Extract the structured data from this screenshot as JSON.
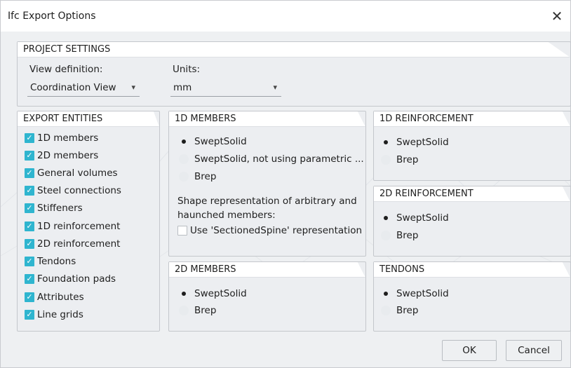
{
  "window": {
    "title": "Ifc Export Options"
  },
  "project_settings": {
    "header": "PROJECT SETTINGS",
    "view_definition_label": "View definition:",
    "view_definition_value": "Coordination View",
    "units_label": "Units:",
    "units_value": "mm"
  },
  "export_entities": {
    "header": "EXPORT ENTITIES",
    "items": [
      {
        "label": "1D members",
        "checked": true
      },
      {
        "label": "2D members",
        "checked": true
      },
      {
        "label": "General volumes",
        "checked": true
      },
      {
        "label": "Steel connections",
        "checked": true
      },
      {
        "label": "Stiffeners",
        "checked": true
      },
      {
        "label": "1D reinforcement",
        "checked": true
      },
      {
        "label": "2D reinforcement",
        "checked": true
      },
      {
        "label": "Tendons",
        "checked": true
      },
      {
        "label": "Foundation pads",
        "checked": true
      },
      {
        "label": "Attributes",
        "checked": true
      },
      {
        "label": "Line grids",
        "checked": true
      }
    ]
  },
  "members_1d": {
    "header": "1D MEMBERS",
    "options": [
      "SweptSolid",
      "SweptSolid, not using parametric ...",
      "Brep"
    ],
    "selected": 0,
    "shape_text_line1": "Shape representation of arbitrary and",
    "shape_text_line2": "haunched members:",
    "sectioned_label": "Use 'SectionedSpine' representation"
  },
  "members_2d": {
    "header": "2D MEMBERS",
    "options": [
      "SweptSolid",
      "Brep"
    ],
    "selected": 0
  },
  "reinf_1d": {
    "header": "1D REINFORCEMENT",
    "options": [
      "SweptSolid",
      "Brep"
    ],
    "selected": 0
  },
  "reinf_2d": {
    "header": "2D REINFORCEMENT",
    "options": [
      "SweptSolid",
      "Brep"
    ],
    "selected": 0
  },
  "tendons": {
    "header": "TENDONS",
    "options": [
      "SweptSolid",
      "Brep"
    ],
    "selected": 0
  },
  "buttons": {
    "ok": "OK",
    "cancel": "Cancel"
  },
  "colors": {
    "checkbox": "#2fb5cf",
    "panel_bg": "#eceef1",
    "header_bg": "#ffffff"
  },
  "icons": {
    "close": "close-icon",
    "chevron": "chevron-down-icon",
    "check": "check-icon"
  }
}
